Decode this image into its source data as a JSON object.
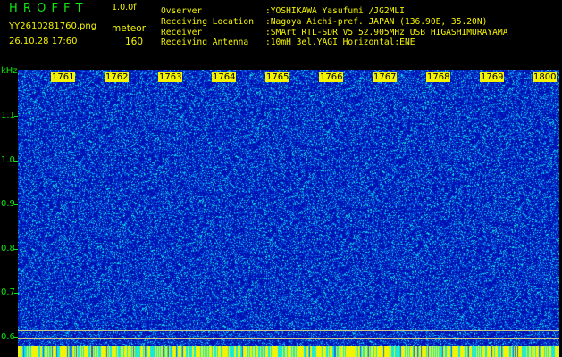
{
  "header": {
    "app_title": "H R O F F T",
    "version": "1.0.0f",
    "filename": "YY2610281760.png",
    "datetime": "26.10.28 17:60",
    "mode": "meteor",
    "count": "160"
  },
  "station_info": [
    {
      "label": "Ovserver",
      "value": ":YOSHIKAWA Yasufumi /JG2MLI"
    },
    {
      "label": "Receiving Location",
      "value": ":Nagoya Aichi-pref. JAPAN (136.90E, 35.20N)"
    },
    {
      "label": "Receiver",
      "value": ":SMArt RTL-SDR V5 52.905MHz USB HIGASHIMURAYAMA"
    },
    {
      "label": "Receiving Antenna",
      "value": ":10mH 3el.YAGI Horizontal:ENE"
    }
  ],
  "y_axis": {
    "unit": "kHz",
    "ticks": [
      "1.1",
      "1.0",
      "0.9",
      "0.8",
      "0.7",
      "0.6"
    ]
  },
  "time_axis": {
    "labels": [
      "1761",
      "1762",
      "1763",
      "1764",
      "1765",
      "1766",
      "1767",
      "1768",
      "1769",
      "1800"
    ]
  },
  "colors": {
    "background": "#000000",
    "plot_background": "#0012b6",
    "noise_light": "#10e8e0",
    "noise_mid": "#0a6ee8",
    "label_yellow": "#f4f400",
    "label_green": "#0fe70f"
  }
}
